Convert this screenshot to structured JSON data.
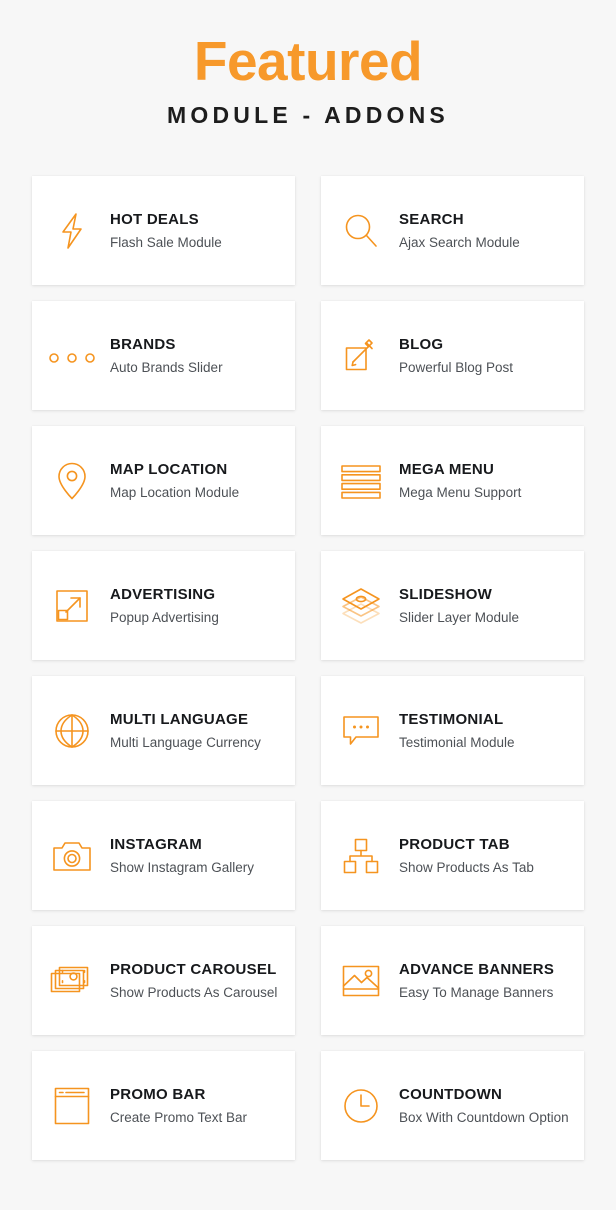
{
  "header": {
    "title": "Featured",
    "subtitle": "MODULE - ADDONS",
    "title_color": "#f7992b",
    "subtitle_color": "#1d1d1d"
  },
  "theme": {
    "background": "#f7f7f7",
    "card_background": "#ffffff",
    "accent": "#f5941f",
    "title_text": "#17191c",
    "desc_text": "#4d5156"
  },
  "modules": [
    {
      "title": "HOT DEALS",
      "desc": "Flash Sale Module",
      "icon": "lightning-bolt-icon"
    },
    {
      "title": "SEARCH",
      "desc": "Ajax Search Module",
      "icon": "magnifier-icon"
    },
    {
      "title": "BRANDS",
      "desc": "Auto Brands Slider",
      "icon": "three-dots-icon"
    },
    {
      "title": "BLOG",
      "desc": "Powerful Blog Post",
      "icon": "pencil-square-icon"
    },
    {
      "title": "MAP LOCATION",
      "desc": "Map Location Module",
      "icon": "map-pin-icon"
    },
    {
      "title": "MEGA MENU",
      "desc": "Mega Menu Support",
      "icon": "menu-bars-icon"
    },
    {
      "title": "ADVERTISING",
      "desc": "Popup Advertising",
      "icon": "expand-arrow-icon"
    },
    {
      "title": "SLIDESHOW",
      "desc": "Slider Layer Module",
      "icon": "layers-icon"
    },
    {
      "title": "MULTI LANGUAGE",
      "desc": "Multi Language Currency",
      "icon": "globe-icon"
    },
    {
      "title": "TESTIMONIAL",
      "desc": "Testimonial Module",
      "icon": "speech-bubble-icon"
    },
    {
      "title": "INSTAGRAM",
      "desc": "Show Instagram Gallery",
      "icon": "camera-icon"
    },
    {
      "title": "PRODUCT TAB",
      "desc": "Show Products As Tab",
      "icon": "sitemap-icon"
    },
    {
      "title": "PRODUCT CAROUSEL",
      "desc": "Show Products As Carousel",
      "icon": "stacked-cards-icon"
    },
    {
      "title": "ADVANCE BANNERS",
      "desc": "Easy To Manage Banners",
      "icon": "image-icon"
    },
    {
      "title": "PROMO BAR",
      "desc": "Create Promo Text Bar",
      "icon": "browser-window-icon"
    },
    {
      "title": "COUNTDOWN",
      "desc": "Box With Countdown Option",
      "icon": "clock-icon"
    }
  ]
}
